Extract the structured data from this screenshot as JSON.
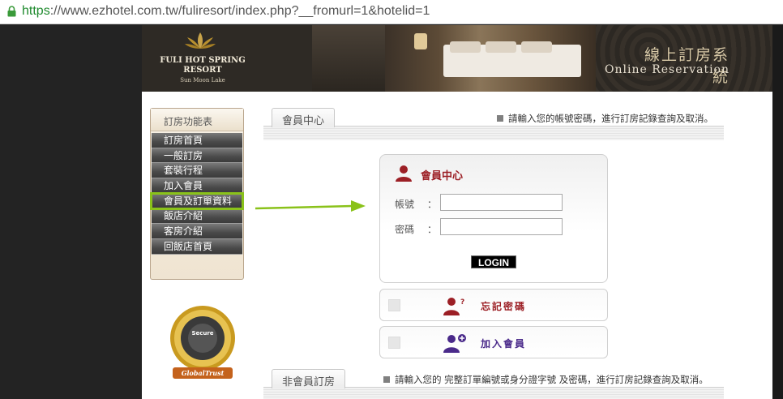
{
  "browser": {
    "url_scheme": "https",
    "url_rest": "://www.ezhotel.com.tw/fuliresort/index.php?__fromurl=1&hotelid=1"
  },
  "banner": {
    "brand_line1": "FULI HOT SPRING",
    "brand_line2": "RESORT",
    "brand_sub": "Sun Moon Lake",
    "system_zh": "線上訂房系統",
    "system_en": "Online Reservation"
  },
  "menu": {
    "title": "訂房功能表",
    "items": [
      {
        "label": "訂房首頁"
      },
      {
        "label": "一般訂房"
      },
      {
        "label": "套裝行程"
      },
      {
        "label": "加入會員"
      },
      {
        "label": "會員及訂單資料"
      },
      {
        "label": "飯店介紹"
      },
      {
        "label": "客房介紹"
      },
      {
        "label": "回飯店首頁"
      }
    ],
    "active_index": 4,
    "highlight_color": "#8ac21a"
  },
  "seal": {
    "center_text": "Secure",
    "brand_text": "GlobalTrust"
  },
  "member": {
    "tab": "會員中心",
    "note": "請輸入您的帳號密碼，進行訂房記錄查詢及取消。",
    "box_title": "會員中心",
    "account_label": "帳號",
    "password_label": "密碼",
    "colon": "：",
    "account_value": "",
    "password_value": "",
    "login_button": "LOGIN"
  },
  "options": {
    "forgot": "忘記密碼",
    "forgot_color": "#9c1f25",
    "join": "加入會員",
    "join_color": "#4a2a8a"
  },
  "nonmember": {
    "tab": "非會員訂房",
    "note": "請輸入您的 完整訂單編號或身分證字號 及密碼，進行訂房記錄查詢及取消。"
  }
}
